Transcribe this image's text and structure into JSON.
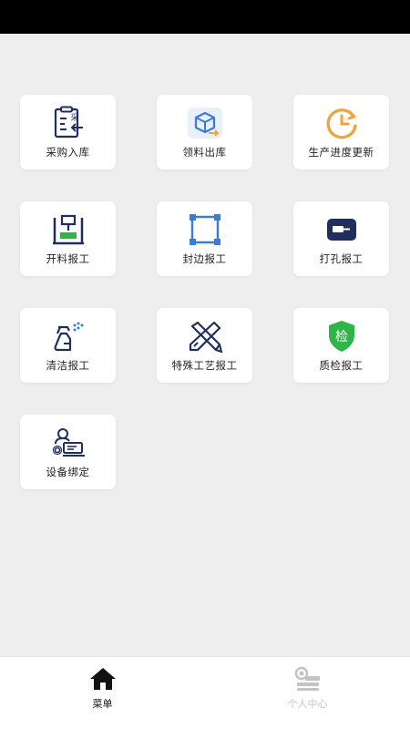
{
  "menu": {
    "items": [
      {
        "label": "采购入库",
        "icon": "purchase-inbound-icon"
      },
      {
        "label": "领料出库",
        "icon": "material-outbound-icon"
      },
      {
        "label": "生产进度更新",
        "icon": "progress-update-icon"
      },
      {
        "label": "开料报工",
        "icon": "cutting-report-icon"
      },
      {
        "label": "封边报工",
        "icon": "edge-banding-report-icon"
      },
      {
        "label": "打孔报工",
        "icon": "drilling-report-icon"
      },
      {
        "label": "清洁报工",
        "icon": "cleaning-report-icon"
      },
      {
        "label": "特殊工艺报工",
        "icon": "special-process-report-icon"
      },
      {
        "label": "质检报工",
        "icon": "quality-inspection-icon"
      },
      {
        "label": "设备绑定",
        "icon": "device-binding-icon"
      }
    ]
  },
  "inspection_badge_text": "检",
  "tabbar": {
    "tabs": [
      {
        "label": "菜单",
        "icon": "home-icon",
        "active": true
      },
      {
        "label": "个人中心",
        "icon": "profile-icon",
        "active": false
      }
    ]
  },
  "colors": {
    "navy": "#1f2e5c",
    "blue": "#3a7bd5",
    "orange": "#f0a33b",
    "green": "#2fb44a",
    "inactive": "#c3c3c3"
  }
}
